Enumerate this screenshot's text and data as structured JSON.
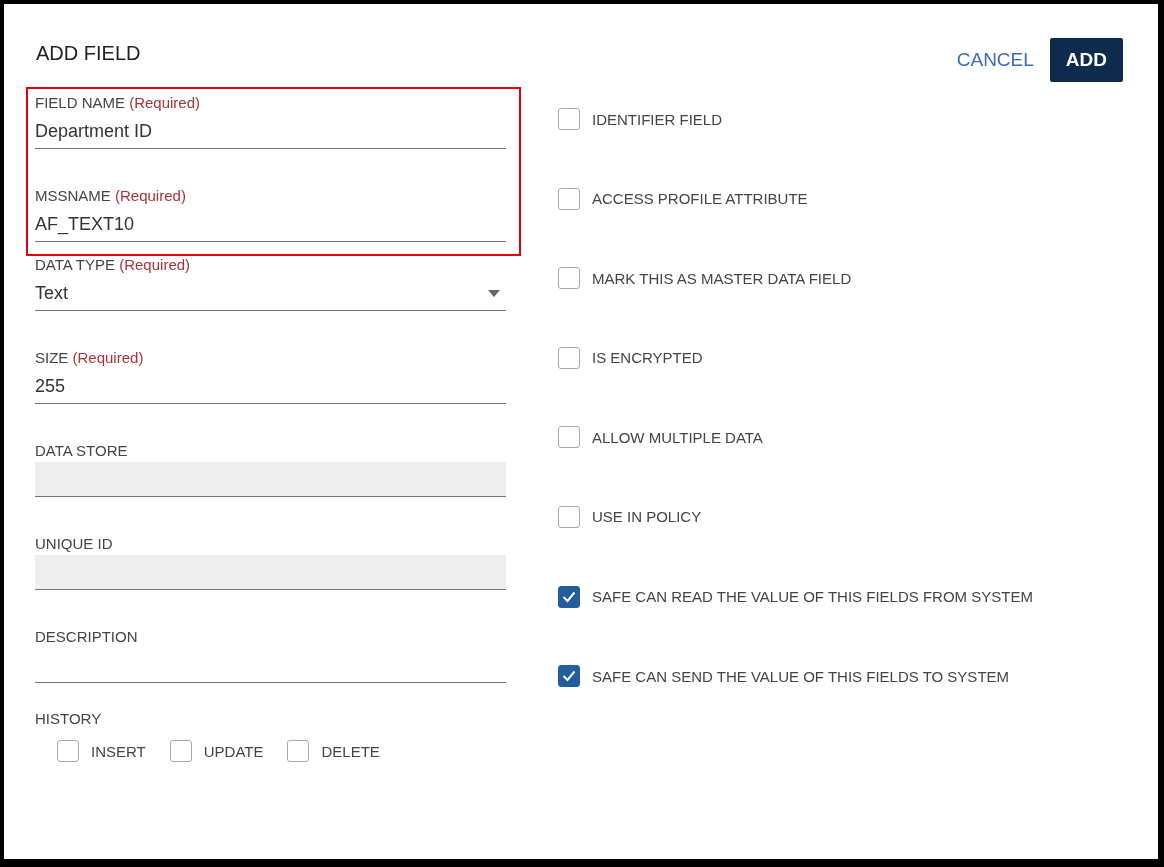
{
  "dialog": {
    "title": "ADD FIELD"
  },
  "actions": {
    "cancel": "CANCEL",
    "add": "ADD"
  },
  "highlight_box": {
    "fields": [
      {
        "kind": "text",
        "label": "FIELD NAME",
        "required": "(Required)",
        "value": "Department ID"
      },
      {
        "kind": "text",
        "label": "MSSNAME",
        "required": "(Required)",
        "value": "AF_TEXT10"
      }
    ]
  },
  "fields": [
    {
      "kind": "dropdown",
      "label": "DATA TYPE",
      "required": "(Required)",
      "value": "Text"
    },
    {
      "kind": "text",
      "label": "SIZE",
      "required": "(Required)",
      "value": "255"
    },
    {
      "kind": "disabled",
      "label": "DATA STORE"
    },
    {
      "kind": "disabled",
      "label": "UNIQUE ID"
    },
    {
      "kind": "text",
      "label": "DESCRIPTION"
    }
  ],
  "history": {
    "label": "HISTORY",
    "options": [
      {
        "label": "INSERT",
        "checked": false
      },
      {
        "label": "UPDATE",
        "checked": false
      },
      {
        "label": "DELETE",
        "checked": false
      }
    ]
  },
  "options": [
    {
      "label": "IDENTIFIER FIELD",
      "checked": false
    },
    {
      "label": "ACCESS PROFILE ATTRIBUTE",
      "checked": false
    },
    {
      "label": "MARK THIS AS MASTER DATA FIELD",
      "checked": false
    },
    {
      "label": "IS ENCRYPTED",
      "checked": false
    },
    {
      "label": "ALLOW MULTIPLE DATA",
      "checked": false
    },
    {
      "label": "USE IN POLICY",
      "checked": false
    },
    {
      "label": "SAFE CAN READ THE VALUE OF THIS FIELDS FROM SYSTEM",
      "checked": true
    },
    {
      "label": "SAFE CAN SEND THE VALUE OF THIS FIELDS TO SYSTEM",
      "checked": true
    }
  ]
}
